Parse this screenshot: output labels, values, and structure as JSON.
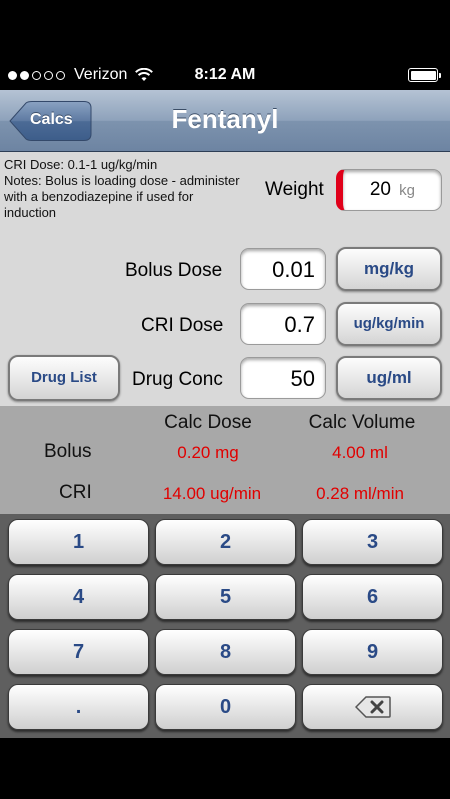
{
  "status_bar": {
    "carrier": "Verizon",
    "time": "8:12 AM",
    "signal_bars_filled": 2,
    "signal_bars_total": 5,
    "icons": [
      "wifi-icon",
      "battery-icon"
    ]
  },
  "nav": {
    "back_label": "Calcs",
    "title": "Fentanyl"
  },
  "notes": {
    "line1": "CRI Dose: 0.1-1 ug/kg/min",
    "line2": "Notes: Bolus is loading dose - administer with a benzodiazepine if used for induction"
  },
  "weight": {
    "label": "Weight",
    "value": "20",
    "unit": "kg"
  },
  "fields": {
    "bolus": {
      "label": "Bolus Dose",
      "value": "0.01",
      "unit": "mg/kg"
    },
    "cri": {
      "label": "CRI Dose",
      "value": "0.7",
      "unit": "ug/kg/min"
    },
    "conc": {
      "label": "Drug Conc",
      "value": "50",
      "unit": "ug/ml"
    }
  },
  "drug_list_label": "Drug List",
  "results": {
    "col_dose": "Calc Dose",
    "col_volume": "Calc Volume",
    "bolus": {
      "label": "Bolus",
      "dose": "0.20 mg",
      "volume": "4.00 ml"
    },
    "cri": {
      "label": "CRI",
      "dose": "14.00 ug/min",
      "volume": "0.28 ml/min"
    }
  },
  "keypad": {
    "keys": [
      "1",
      "2",
      "3",
      "4",
      "5",
      "6",
      "7",
      "8",
      "9",
      ".",
      "0"
    ],
    "backspace_icon": "backspace-icon"
  },
  "colors": {
    "accent_blue": "#2a4a86",
    "result_red": "#e10000",
    "active_field": "#e0001a"
  }
}
